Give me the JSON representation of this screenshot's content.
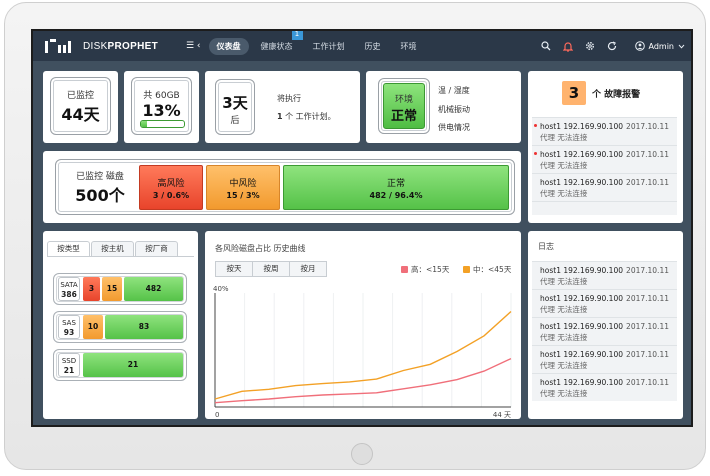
{
  "app": {
    "brand_prefix": "DISK",
    "brand_suffix": "PROPHET",
    "menu_toggle": "☰ ‹",
    "admin_label": "Admin"
  },
  "nav": {
    "items": [
      {
        "label": "仪表盘",
        "active": true
      },
      {
        "label": "健康状态",
        "badge": "1"
      },
      {
        "label": "工作计划"
      },
      {
        "label": "历史"
      },
      {
        "label": "环境"
      }
    ]
  },
  "stats": {
    "monitored_label": "已监控",
    "monitored_value": "44天",
    "capacity_label": "共 60GB",
    "capacity_value": "13%",
    "capacity_fill": 0.13,
    "plan_days": "3天",
    "plan_after": "后",
    "plan_text1": "将执行",
    "plan_count": "1",
    "plan_text2": "个 工作计划。",
    "env_label": "环境",
    "env_value": "正常",
    "env_items": [
      "温 / 湿度",
      "机械振动",
      "供电情况"
    ]
  },
  "risk": {
    "monitored_disks_label": "已监控 磁盘",
    "monitored_disks_value": "500个",
    "high_label": "高风险",
    "high_value": "3 / 0.6%",
    "mid_label": "中风险",
    "mid_value": "15 / 3%",
    "ok_label": "正常",
    "ok_value": "482 / 96.4%"
  },
  "alerts": {
    "count": "3",
    "title": "个 故障报警",
    "rows": [
      {
        "host": "host1 192.169.90.100",
        "date": "2017.10.11",
        "msg": "代理 无法连接",
        "dot": true
      },
      {
        "host": "host1 192.169.90.100",
        "date": "2017.10.11",
        "msg": "代理 无法连接",
        "dot": true
      },
      {
        "host": "host1 192.169.90.100",
        "date": "2017.10.11",
        "msg": "代理 无法连接",
        "dot": false
      }
    ]
  },
  "logs": {
    "title": "日志",
    "rows": [
      {
        "host": "host1 192.169.90.100",
        "date": "2017.10.11",
        "msg": "代理 无法连接"
      },
      {
        "host": "host1 192.169.90.100",
        "date": "2017.10.11",
        "msg": "代理 无法连接"
      },
      {
        "host": "host1 192.169.90.100",
        "date": "2017.10.11",
        "msg": "代理 无法连接"
      },
      {
        "host": "host1 192.169.90.100",
        "date": "2017.10.11",
        "msg": "代理 无法连接"
      },
      {
        "host": "host1 192.169.90.100",
        "date": "2017.10.11",
        "msg": "代理 无法连接"
      }
    ]
  },
  "disk_types": {
    "tabs": [
      "按类型",
      "按主机",
      "按厂商"
    ],
    "rows": [
      {
        "name": "SATA",
        "total": "386",
        "high": "3",
        "mid": "15",
        "ok": "482"
      },
      {
        "name": "SAS",
        "total": "93",
        "high": "",
        "mid": "10",
        "ok": "83"
      },
      {
        "name": "SSD",
        "total": "21",
        "high": "",
        "mid": "",
        "ok": "21"
      }
    ]
  },
  "history": {
    "title": "各风险磁盘占比 历史曲线",
    "period_tabs": [
      "按天",
      "按周",
      "按月"
    ],
    "legend_high": "高：<15天",
    "legend_mid": "中：<45天",
    "colors": {
      "high": "#f06f7a",
      "mid": "#f3a126"
    }
  },
  "chart_data": {
    "type": "line",
    "ylabel": "40%",
    "x_start": "0",
    "x_end": "44 天",
    "xlim": [
      0,
      44
    ],
    "ylim": [
      0,
      40
    ],
    "series": [
      {
        "name": "高：<15天",
        "x": [
          0,
          4,
          8,
          12,
          16,
          20,
          24,
          28,
          32,
          36,
          40,
          44
        ],
        "values": [
          1.5,
          2.2,
          2.8,
          3.6,
          4.2,
          4.6,
          5.0,
          6.4,
          7.8,
          9.6,
          12.6,
          17.0
        ]
      },
      {
        "name": "中：<45天",
        "x": [
          0,
          4,
          8,
          12,
          16,
          20,
          24,
          28,
          32,
          36,
          40,
          44
        ],
        "values": [
          2.8,
          5.5,
          6.2,
          7.5,
          8.2,
          8.8,
          9.8,
          12.8,
          15.0,
          19.5,
          25.0,
          33.5
        ]
      }
    ]
  }
}
